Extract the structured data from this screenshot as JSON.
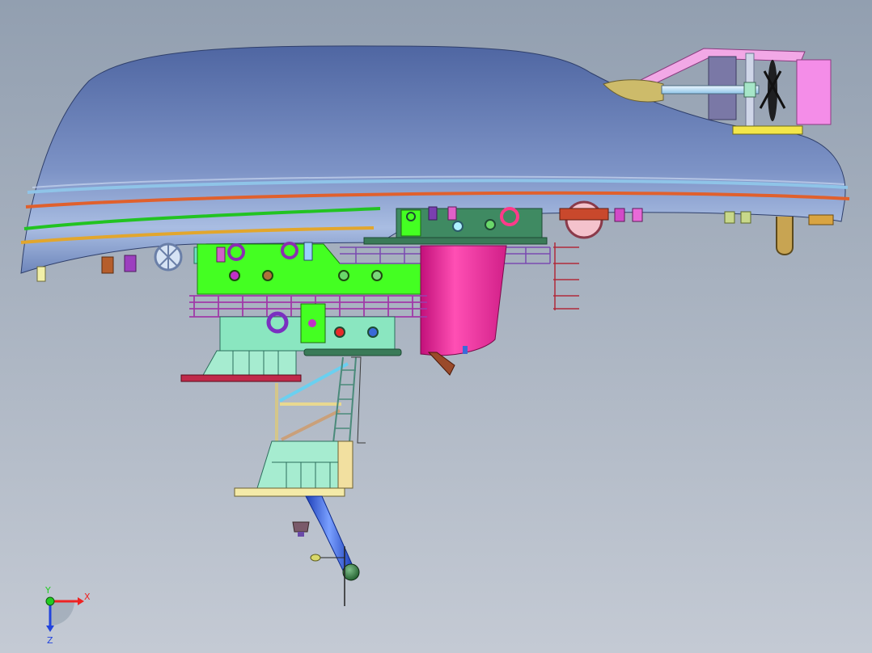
{
  "viewport": {
    "background_top": "#929fb0",
    "background_bottom": "#c4cad4"
  },
  "model": {
    "hull_color": "#5d76ad",
    "stripe_colors": [
      "#8fc4e8",
      "#e0602d",
      "#22c322",
      "#e2a62d"
    ],
    "deck_color": "#44ff22",
    "accent_color": "#ff33aa",
    "frame_color": "#a6e6c8",
    "pink_frame_color": "#f08ad8"
  },
  "triad": {
    "x_label": "X",
    "y_label": "Y",
    "z_label": "Z",
    "x_color": "#ee2222",
    "y_color": "#22cc22",
    "z_color": "#2244dd"
  }
}
